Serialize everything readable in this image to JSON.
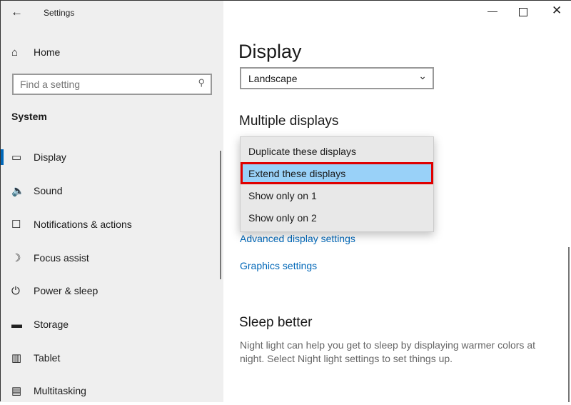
{
  "window": {
    "title": "Settings"
  },
  "sidebar": {
    "home": "Home",
    "search_placeholder": "Find a setting",
    "section": "System",
    "items": [
      {
        "label": "Display",
        "icon": "monitor-icon",
        "selected": true
      },
      {
        "label": "Sound",
        "icon": "speaker-icon"
      },
      {
        "label": "Notifications & actions",
        "icon": "notification-icon"
      },
      {
        "label": "Focus assist",
        "icon": "moon-icon"
      },
      {
        "label": "Power & sleep",
        "icon": "power-icon"
      },
      {
        "label": "Storage",
        "icon": "storage-icon"
      },
      {
        "label": "Tablet",
        "icon": "tablet-icon"
      },
      {
        "label": "Multitasking",
        "icon": "multitasking-icon"
      }
    ]
  },
  "main": {
    "title": "Display",
    "orientation_value": "Landscape",
    "multiple_displays_heading": "Multiple displays",
    "dropdown_options": [
      "Duplicate these displays",
      "Extend these displays",
      "Show only on 1",
      "Show only on 2"
    ],
    "selected_option": "Extend these displays",
    "links": {
      "advanced": "Advanced display settings",
      "graphics": "Graphics settings"
    },
    "sleep_heading": "Sleep better",
    "sleep_text": "Night light can help you get to sleep by displaying warmer colors at night. Select Night light settings to set things up."
  },
  "colors": {
    "accent": "#0067b8",
    "highlight": "#99d1f8",
    "annotation": "#e00000"
  }
}
